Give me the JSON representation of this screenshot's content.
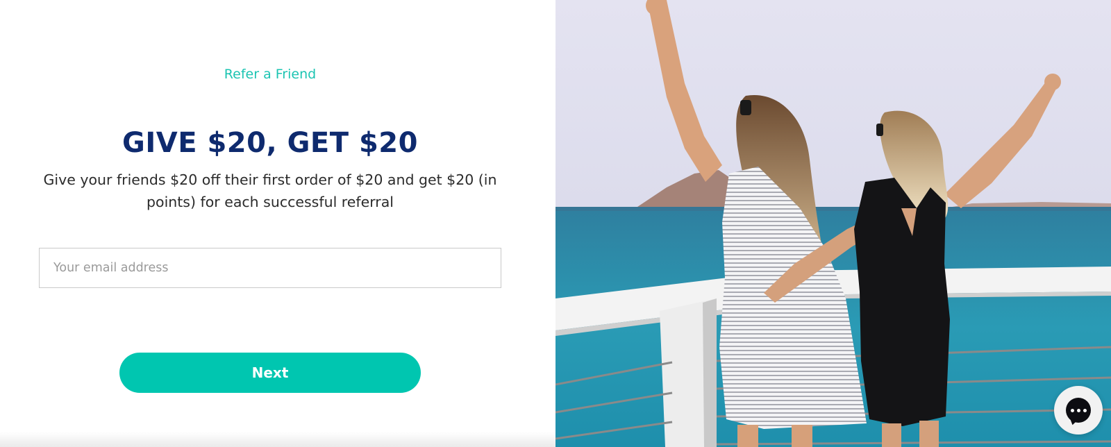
{
  "referral": {
    "eyebrow": "Refer a Friend",
    "headline": "GIVE $20, GET $20",
    "description": "Give your friends $20 off their first order of $20 and get $20 (in points) for each successful referral",
    "email_placeholder": "Your email address",
    "next_label": "Next"
  },
  "photo": {
    "icon": "photo-two-women-on-pier"
  },
  "chat": {
    "icon": "chat-bubble-icon"
  },
  "colors": {
    "accent": "#00c6b0",
    "eyebrow": "#1cc4b2",
    "headline": "#0e2a6e",
    "body_text": "#2b2b2b"
  }
}
